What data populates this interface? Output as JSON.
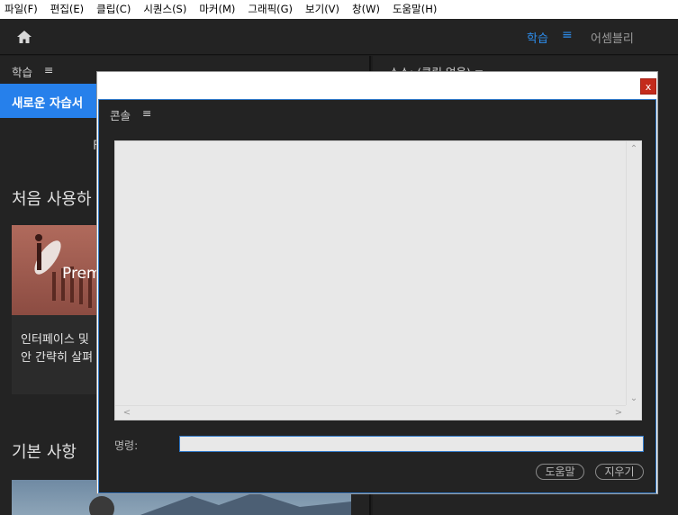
{
  "menu": {
    "items": [
      "파일(F)",
      "편집(E)",
      "클립(C)",
      "시퀀스(S)",
      "마커(M)",
      "그래픽(G)",
      "보기(V)",
      "창(W)",
      "도움말(H)"
    ]
  },
  "header": {
    "home_icon": "home-icon",
    "workspaces": {
      "learn": "학습",
      "menu_icon": "≡",
      "assembly": "어셈블리"
    }
  },
  "left_panel": {
    "tab_label": "학습",
    "tab_menu": "≡",
    "new_tutorial_button": "새로운 자습서",
    "fragment": "F",
    "first_use_heading": "처음 사용하",
    "card": {
      "thumb_label": "Prem",
      "desc_line1": "인터페이스 및",
      "desc_line2": "안 간략히 살펴"
    },
    "basics_heading": "기본 사항"
  },
  "right_panel": {
    "title": "소스: (클립 없음)  ≡"
  },
  "console_dialog": {
    "close_label": "x",
    "tab_label": "콘솔",
    "tab_menu": "≡",
    "command_label": "명령:",
    "command_value": "",
    "help_button": "도움말",
    "clear_button": "지우기",
    "scroll_up": "⌃",
    "scroll_down": "⌄",
    "scroll_left": "<",
    "scroll_right": ">"
  },
  "colors": {
    "accent": "#2680eb",
    "active_workspace": "#2d8ceb",
    "close_button": "#c42b1c",
    "panel_bg": "#232323"
  }
}
